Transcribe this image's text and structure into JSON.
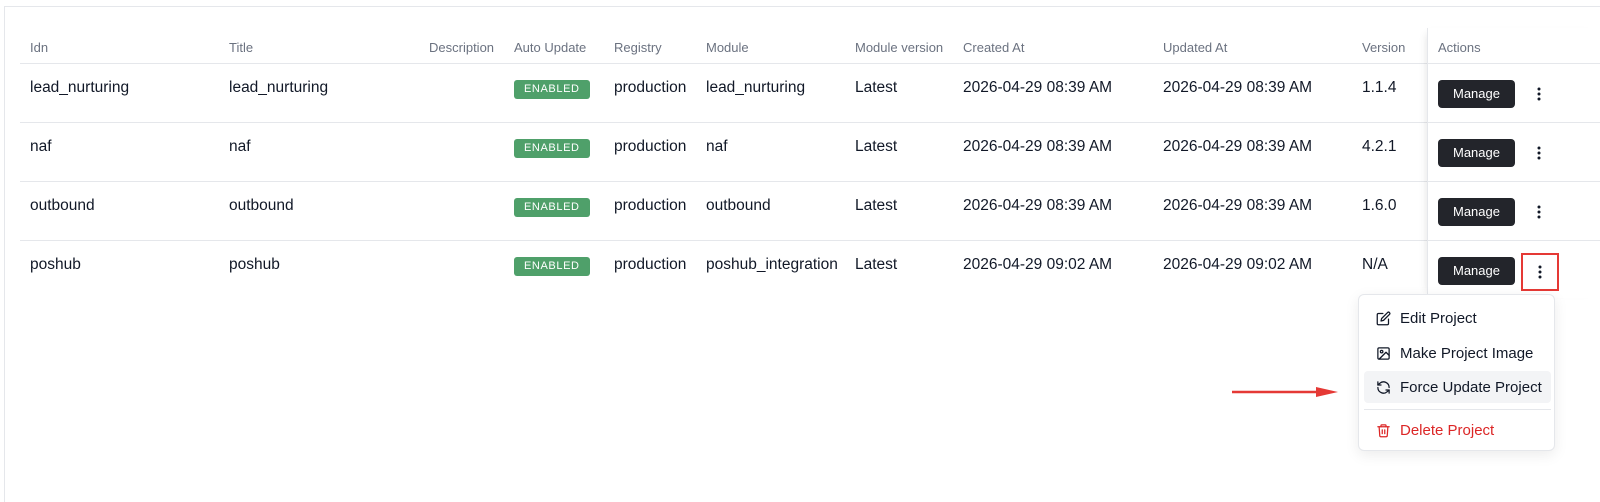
{
  "table": {
    "headers": {
      "idn": "Idn",
      "title": "Title",
      "description": "Description",
      "auto_update": "Auto Update",
      "registry": "Registry",
      "module": "Module",
      "module_version": "Module version",
      "created_at": "Created At",
      "updated_at": "Updated At",
      "version": "Version",
      "actions": "Actions"
    },
    "rows": [
      {
        "idn": "lead_nurturing",
        "title": "lead_nurturing",
        "description": "",
        "auto_update": "ENABLED",
        "registry": "production",
        "module": "lead_nurturing",
        "module_version": "Latest",
        "created_at": "2026-04-29 08:39 AM",
        "updated_at": "2026-04-29 08:39 AM",
        "version": "1.1.4",
        "manage_label": "Manage"
      },
      {
        "idn": "naf",
        "title": "naf",
        "description": "",
        "auto_update": "ENABLED",
        "registry": "production",
        "module": "naf",
        "module_version": "Latest",
        "created_at": "2026-04-29 08:39 AM",
        "updated_at": "2026-04-29 08:39 AM",
        "version": "4.2.1",
        "manage_label": "Manage"
      },
      {
        "idn": "outbound",
        "title": "outbound",
        "description": "",
        "auto_update": "ENABLED",
        "registry": "production",
        "module": "outbound",
        "module_version": "Latest",
        "created_at": "2026-04-29 08:39 AM",
        "updated_at": "2026-04-29 08:39 AM",
        "version": "1.6.0",
        "manage_label": "Manage"
      },
      {
        "idn": "poshub",
        "title": "poshub",
        "description": "",
        "auto_update": "ENABLED",
        "registry": "production",
        "module": "poshub_integration",
        "module_version": "Latest",
        "created_at": "2026-04-29 09:02 AM",
        "updated_at": "2026-04-29 09:02 AM",
        "version": "N/A",
        "manage_label": "Manage"
      }
    ]
  },
  "dropdown_menu": {
    "items": [
      {
        "label": "Edit Project",
        "icon": "edit-icon"
      },
      {
        "label": "Make Project Image",
        "icon": "image-icon"
      },
      {
        "label": "Force Update Project",
        "icon": "refresh-icon"
      },
      {
        "label": "Delete Project",
        "icon": "trash-icon"
      }
    ]
  },
  "colors": {
    "badge_enabled": "#4fa06a",
    "manage_button": "#23252b",
    "danger": "#dc2626",
    "annotation": "#e53935"
  }
}
